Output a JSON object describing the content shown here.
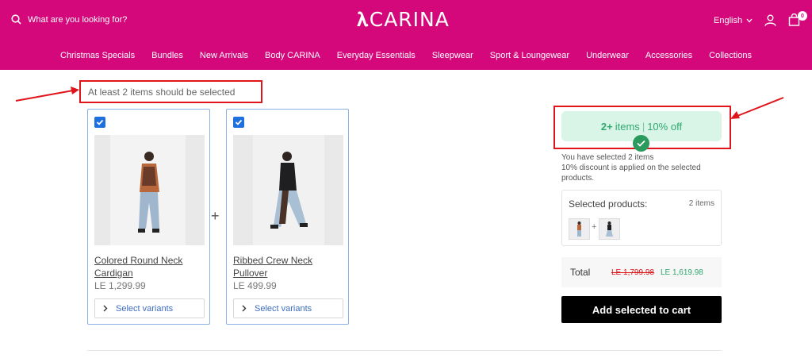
{
  "header": {
    "search_placeholder": "What are you looking for?",
    "logo_text": "CARINA",
    "language": "English",
    "cart_count": "0",
    "bg_color": "#d4087a"
  },
  "nav": [
    "Christmas Specials",
    "Bundles",
    "New Arrivals",
    "Body CARINA",
    "Everyday Essentials",
    "Sleepwear",
    "Sport & Loungewear",
    "Underwear",
    "Accessories",
    "Collections"
  ],
  "bundle": {
    "warning": "At least 2 items should be selected",
    "plus": "+",
    "products": [
      {
        "title": "Colored Round Neck Cardigan",
        "price": "LE 1,299.99",
        "variants_label": "Select variants",
        "checked": true
      },
      {
        "title": "Ribbed Crew Neck Pullover",
        "price": "LE 499.99",
        "variants_label": "Select variants",
        "checked": true
      }
    ]
  },
  "summary": {
    "offer_count": "2+",
    "offer_items": "items",
    "offer_sep": "|",
    "offer_discount": "10% off",
    "selected_text": "You have selected 2 items",
    "discount_text": "10% discount is applied on the selected products.",
    "selected_label": "Selected products:",
    "selected_count": "2 items",
    "thumb_plus": "+",
    "total_label": "Total",
    "total_old": "LE 1,799.98",
    "total_new": "LE 1,619.98",
    "add_button": "Add selected to cart"
  },
  "colors": {
    "accent": "#d4087a",
    "success": "#2fa86e",
    "alert": "#e0141b",
    "checkbox": "#1e6fe0"
  }
}
